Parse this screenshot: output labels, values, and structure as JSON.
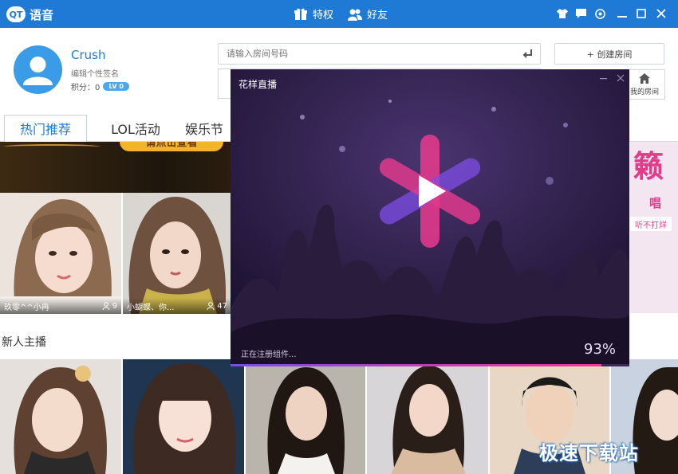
{
  "app": {
    "logo_badge": "QT",
    "logo_text": "语音"
  },
  "top_nav": {
    "privilege": "特权",
    "friends": "好友"
  },
  "profile": {
    "username": "Crush",
    "signature": "编辑个性签名",
    "points_label": "积分：0",
    "level": "LV 0"
  },
  "search": {
    "placeholder": "请输入房间号码"
  },
  "buttons": {
    "create_room": "+ 创建房间",
    "my_room": "我的房间"
  },
  "tabs": [
    "热门推荐",
    "LOL活动",
    "娱乐节"
  ],
  "banner": {
    "button_text": "请点击查看"
  },
  "promo": {
    "big": "籁",
    "small": "唱",
    "tag": "听不打烊"
  },
  "hot_rooms": [
    {
      "name": "玖零^^小冉",
      "viewers": "9"
    },
    {
      "name": "小蝴蝶、你...",
      "viewers": "47"
    }
  ],
  "section_new": "新人主播",
  "overlay": {
    "title": "花样直播",
    "status": "正在注册组件...",
    "progress_text": "93%",
    "progress_value": 0.93
  },
  "watermark": "极速下载站",
  "colors": {
    "brand": "#1f7ad6",
    "accent_pink": "#f03a8e",
    "accent_purple": "#6f4de0"
  }
}
